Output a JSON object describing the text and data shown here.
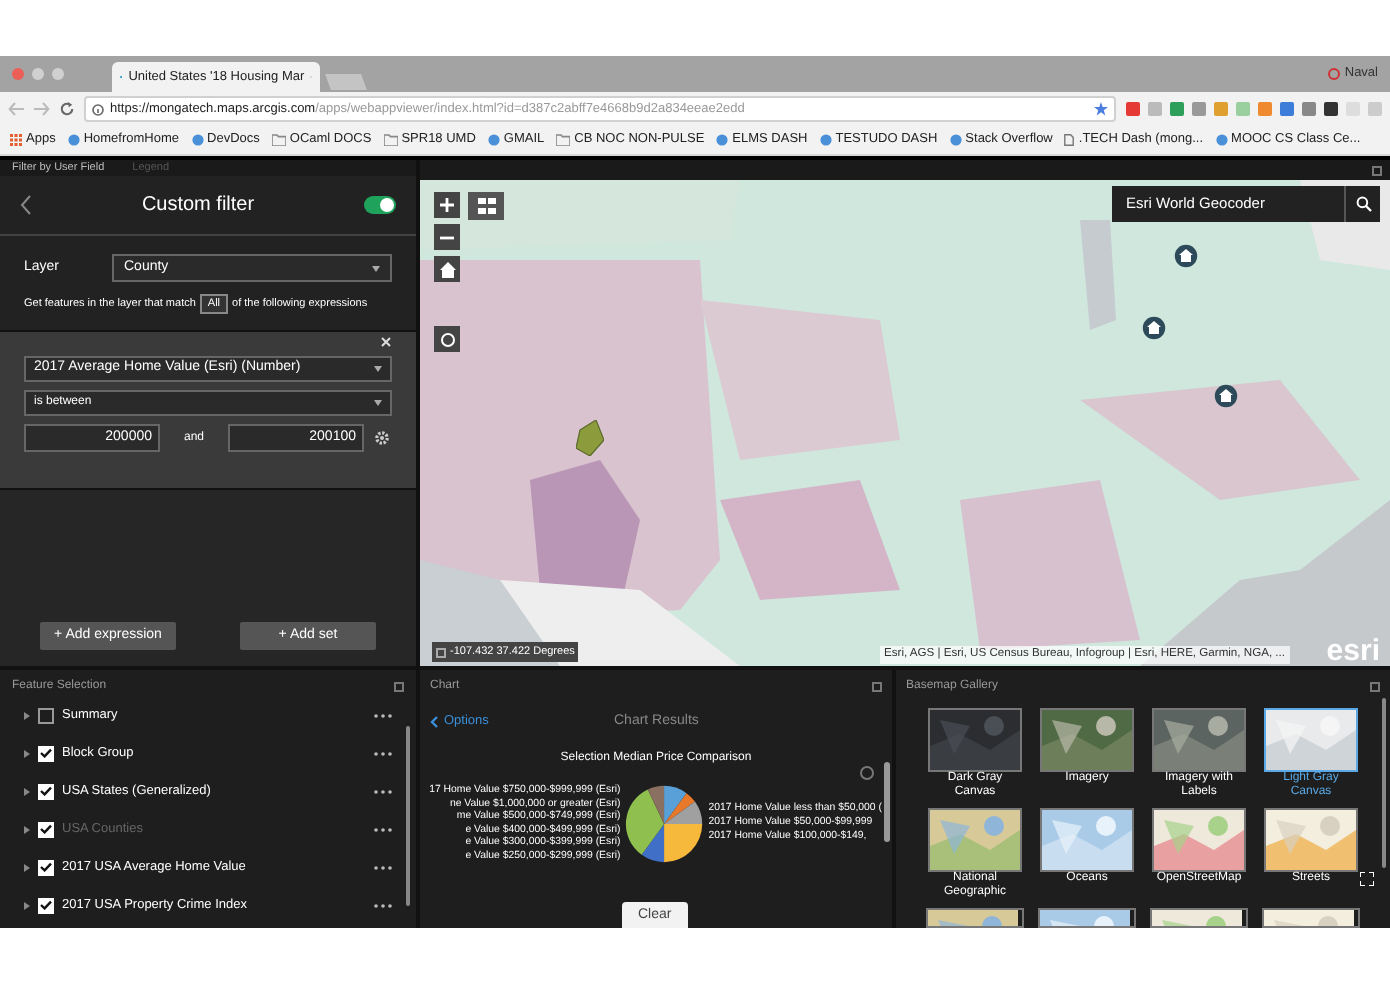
{
  "browser": {
    "tab_title": "United States '18 Housing Mar",
    "user": "Naval",
    "url_host": "https://mongatech.maps.arcgis.com",
    "url_path": "/apps/webappviewer/index.html?id=d387c2abff7e4668b9d2a834eeae2edd",
    "bookmarks": [
      {
        "label": "Apps",
        "kind": "grid"
      },
      {
        "label": "HomefromHome",
        "kind": "site"
      },
      {
        "label": "DevDocs",
        "kind": "site"
      },
      {
        "label": "OCaml DOCS",
        "kind": "folder"
      },
      {
        "label": "SPR18 UMD",
        "kind": "folder"
      },
      {
        "label": "GMAIL",
        "kind": "site"
      },
      {
        "label": "CB NOC NON-PULSE",
        "kind": "folder"
      },
      {
        "label": "ELMS DASH",
        "kind": "site"
      },
      {
        "label": "TESTUDO DASH",
        "kind": "site"
      },
      {
        "label": "Stack Overflow",
        "kind": "site"
      },
      {
        "label": ".TECH Dash (mong...",
        "kind": "page"
      },
      {
        "label": "MOOC CS Class Ce...",
        "kind": "site"
      }
    ]
  },
  "filter_panel": {
    "tabs": [
      {
        "label": "Filter by User Field",
        "selected": true
      },
      {
        "label": "Legend",
        "selected": false
      }
    ],
    "title": "Custom filter",
    "enabled": true,
    "layer_label": "Layer",
    "layer_value": "County",
    "match_before": "Get features in the layer that match",
    "match_value": "All",
    "match_after": "of the following expressions",
    "field": "2017 Average Home Value (Esri) (Number)",
    "operator": "is between",
    "value_from": "200000",
    "and": "and",
    "value_to": "200100",
    "buttons": [
      "+ Add expression",
      "+ Add set"
    ]
  },
  "map": {
    "search_placeholder": "Esri World Geocoder",
    "coordinates": "-107.432 37.422 Degrees",
    "attribution": "Esri, AGS | Esri, US Census Bureau, Infogroup | Esri, HERE, Garmin, NGA, ...",
    "logo": "esri"
  },
  "feature_selection": {
    "title": "Feature Selection",
    "layers": [
      {
        "label": "Summary",
        "checked": false,
        "disabled": false
      },
      {
        "label": "Block Group",
        "checked": true,
        "disabled": false
      },
      {
        "label": "USA States (Generalized)",
        "checked": true,
        "disabled": false
      },
      {
        "label": "USA Counties",
        "checked": true,
        "disabled": true
      },
      {
        "label": "2017 USA Average Home Value",
        "checked": true,
        "disabled": false
      },
      {
        "label": "2017 USA Property Crime Index",
        "checked": true,
        "disabled": false
      }
    ]
  },
  "chart": {
    "title": "Chart",
    "back": "Options",
    "heading": "Chart Results",
    "chart_title": "Selection Median Price Comparison",
    "left_labels": [
      "17 Home Value $750,000-$999,999 (Esri)",
      "ne Value $1,000,000 or greater (Esri)",
      "me Value $500,000-$749,999 (Esri)",
      "e Value $400,000-$499,999 (Esri)",
      "e Value $300,000-$399,999 (Esri)",
      "e Value $250,000-$299,999 (Esri)"
    ],
    "right_labels": [
      "2017 Home Value less than $50,000 (",
      "2017 Home Value $50,000-$99,999",
      "2017 Home Value $100,000-$149,"
    ],
    "clear": "Clear"
  },
  "basemap": {
    "title": "Basemap Gallery",
    "items": [
      {
        "label": "Dark Gray Canvas",
        "selected": false
      },
      {
        "label": "Imagery",
        "selected": false
      },
      {
        "label": "Imagery with Labels",
        "selected": false
      },
      {
        "label": "Light Gray Canvas",
        "selected": true
      },
      {
        "label": "National Geographic",
        "selected": false
      },
      {
        "label": "Oceans",
        "selected": false
      },
      {
        "label": "OpenStreetMap",
        "selected": false
      },
      {
        "label": "Streets",
        "selected": false
      }
    ]
  }
}
